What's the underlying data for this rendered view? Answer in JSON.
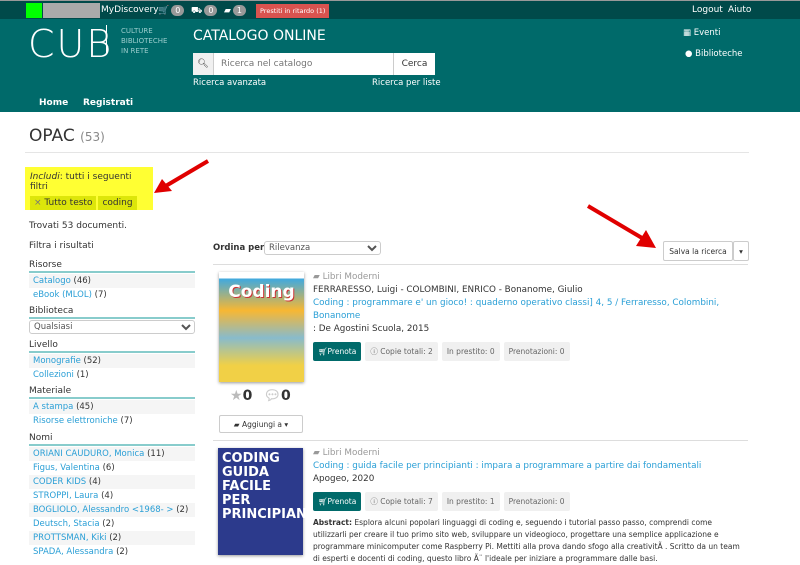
{
  "topbar": {
    "user": "MyDiscovery",
    "cart_count": "0",
    "truck_count": "0",
    "book_count": "1",
    "late_loans": "Prestiti in ritardo (1)",
    "logout": "Logout",
    "help": "Aiuto"
  },
  "header": {
    "logo": "CUB",
    "logo_sub": [
      "CULTURE",
      "BIBLIOTECHE",
      "IN RETE"
    ],
    "title": "CATALOGO ONLINE",
    "search_placeholder": "Ricerca nel catalogo",
    "search_button": "Cerca",
    "advanced": "Ricerca avanzata",
    "lists": "Ricerca per liste",
    "events": "Eventi",
    "libraries": "Biblioteche"
  },
  "nav": {
    "home": "Home",
    "register": "Registrati"
  },
  "page": {
    "title": "OPAC",
    "count": "(53)"
  },
  "filters": {
    "include_label": "Includi",
    "include_text": ": tutti i seguenti filtri",
    "chip_field": "Tutto testo",
    "chip_value": "coding"
  },
  "sidebar": {
    "found": "Trovati 53 documenti.",
    "filter_title": "Filtra i risultati",
    "risorse": {
      "title": "Risorse",
      "items": [
        {
          "label": "Catalogo",
          "count": "(46)"
        },
        {
          "label": "eBook (MLOL)",
          "count": "(7)"
        }
      ]
    },
    "biblioteca": {
      "title": "Biblioteca",
      "selected": "Qualsiasi"
    },
    "livello": {
      "title": "Livello",
      "items": [
        {
          "label": "Monografie",
          "count": "(52)"
        },
        {
          "label": "Collezioni",
          "count": "(1)"
        }
      ]
    },
    "materiale": {
      "title": "Materiale",
      "items": [
        {
          "label": "A stampa",
          "count": "(45)"
        },
        {
          "label": "Risorse elettroniche",
          "count": "(7)"
        }
      ]
    },
    "nomi": {
      "title": "Nomi",
      "items": [
        {
          "label": "ORIANI CAUDURO, Monica",
          "count": "(11)"
        },
        {
          "label": "Figus, Valentina",
          "count": "(6)"
        },
        {
          "label": "CODER KIDS",
          "count": "(4)"
        },
        {
          "label": "STROPPI, Laura",
          "count": "(4)"
        },
        {
          "label": "BOGLIOLO, Alessandro <1968- >",
          "count": "(2)"
        },
        {
          "label": "Deutsch, Stacia",
          "count": "(2)"
        },
        {
          "label": "PROTTSMAN, Kiki",
          "count": "(2)"
        },
        {
          "label": "SPADA, Alessandra",
          "count": "(2)"
        }
      ]
    }
  },
  "results": {
    "sort_label": "Ordina per",
    "sort_value": "Rilevanza",
    "save_search": "Salva la ricerca",
    "items": [
      {
        "type": "Libri Moderni",
        "authors": "FERRARESSO, Luigi - COLOMBINI, ENRICO - Bonanome, Giulio",
        "title": "Coding : programmare e' un gioco! : quaderno operativo classi] 4, 5 / Ferraresso, Colombini, Bonanome",
        "publisher": ": De Agostini Scuola, 2015",
        "reserve": "Prenota",
        "copies": "Copie totali: 2",
        "loaned": "In prestito: 0",
        "holds": "Prenotazioni: 0",
        "stars": "0",
        "comments": "0",
        "add_to": "Aggiungi a",
        "cover_text": "Coding"
      },
      {
        "type": "Libri Moderni",
        "title": "Coding : guida facile per principianti : impara a programmare a partire dai fondamentali",
        "publisher": "Apogeo, 2020",
        "reserve": "Prenota",
        "copies": "Copie totali: 7",
        "loaned": "In prestito: 1",
        "holds": "Prenotazioni: 0",
        "abstract_label": "Abstract:",
        "abstract": "Esplora alcuni popolari linguaggi di coding e, seguendo i tutorial passo passo, comprendi come utilizzarli per creare il tuo primo sito web, sviluppare un videogioco, progettare una semplice applicazione e programmare minicomputer come Raspberry Pi. Mettiti alla prova dando sfogo alla creativitÃ . Scritto da un team di esperti e docenti di coding, questo libro Ã¨ l'ideale per iniziare a programmare dalle basi.",
        "cover_text": "CODING GUIDA FACILE PER PRINCIPIANTI"
      }
    ]
  },
  "colors": {
    "header": "#006a6a",
    "topbar": "#004a4a",
    "link": "#2a9fd6",
    "highlight": "#ffff33",
    "annotation_arrow": "#e00000"
  }
}
